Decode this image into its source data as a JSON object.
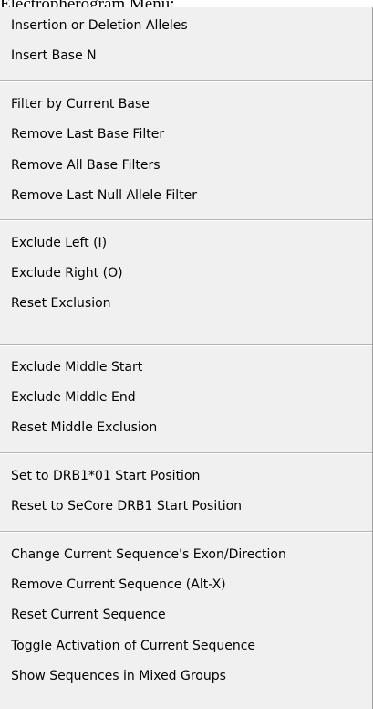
{
  "page_title": "Electropherogram Menu:",
  "menu": {
    "groups": [
      {
        "items": [
          {
            "label": "Insertion or Deletion Alleles"
          },
          {
            "label": "Insert Base N"
          }
        ]
      },
      {
        "items": [
          {
            "label": "Filter by Current Base"
          },
          {
            "label": "Remove Last Base Filter"
          },
          {
            "label": "Remove All Base Filters"
          },
          {
            "label": "Remove Last Null Allele Filter"
          }
        ]
      },
      {
        "items": [
          {
            "label": "Exclude Left  (I)"
          },
          {
            "label": "Exclude Right  (O)"
          },
          {
            "label": "Reset Exclusion"
          }
        ]
      },
      {
        "items": [
          {
            "label": "Exclude Middle Start"
          },
          {
            "label": "Exclude Middle End"
          },
          {
            "label": "Reset Middle Exclusion"
          }
        ]
      },
      {
        "items": [
          {
            "label": "Set to DRB1*01 Start Position"
          },
          {
            "label": "Reset to SeCore DRB1 Start Position"
          }
        ]
      },
      {
        "items": [
          {
            "label": "Change Current Sequence's Exon/Direction"
          },
          {
            "label": "Remove Current Sequence  (Alt-X)"
          },
          {
            "label": "Reset Current Sequence"
          },
          {
            "label": "Toggle Activation of Current Sequence"
          },
          {
            "label": "Show Sequences in Mixed Groups"
          }
        ]
      }
    ]
  }
}
